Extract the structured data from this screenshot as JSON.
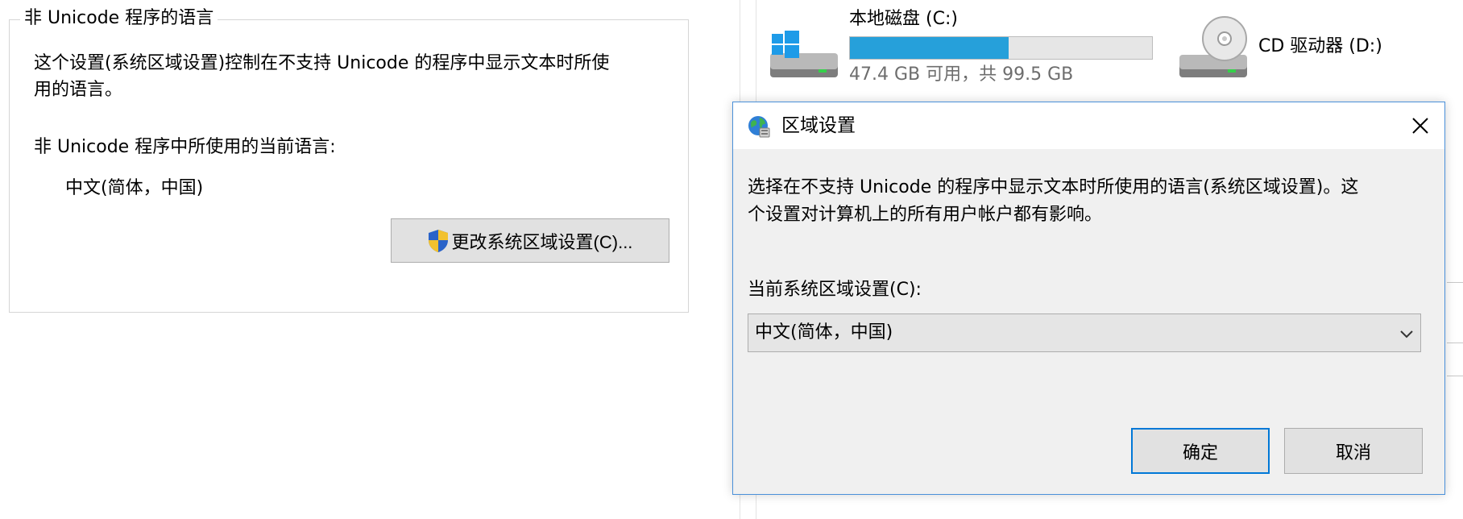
{
  "language_panel": {
    "legend": "非 Unicode 程序的语言",
    "description_line1": "这个设置(系统区域设置)控制在不支持 Unicode 的程序中显示文本时所使",
    "description_line2": "用的语言。",
    "current_label": "非 Unicode 程序中所使用的当前语言:",
    "current_value": "中文(简体，中国)",
    "change_button": "更改系统区域设置(C)..."
  },
  "explorer": {
    "drive_c": {
      "label": "本地磁盘 (C:)",
      "space": "47.4 GB 可用，共 99.5 GB",
      "used_fraction": 0.524
    },
    "drive_d": {
      "label": "CD 驱动器 (D:)"
    }
  },
  "dialog": {
    "title": "区域设置",
    "description_line1": "选择在不支持 Unicode 的程序中显示文本时所使用的语言(系统区域设置)。这",
    "description_line2": "个设置对计算机上的所有用户帐户都有影响。",
    "locale_label": "当前系统区域设置(C):",
    "locale_value": "中文(简体，中国)",
    "ok_label": "确定",
    "cancel_label": "取消"
  },
  "colors": {
    "accent": "#0078d7",
    "usage_bar": "#26a0da",
    "dialog_bg": "#f0f0f0"
  },
  "icons": [
    "shield-icon",
    "windows-drive-icon",
    "cd-drive-icon",
    "globe-icon",
    "close-icon",
    "chevron-down-icon"
  ]
}
